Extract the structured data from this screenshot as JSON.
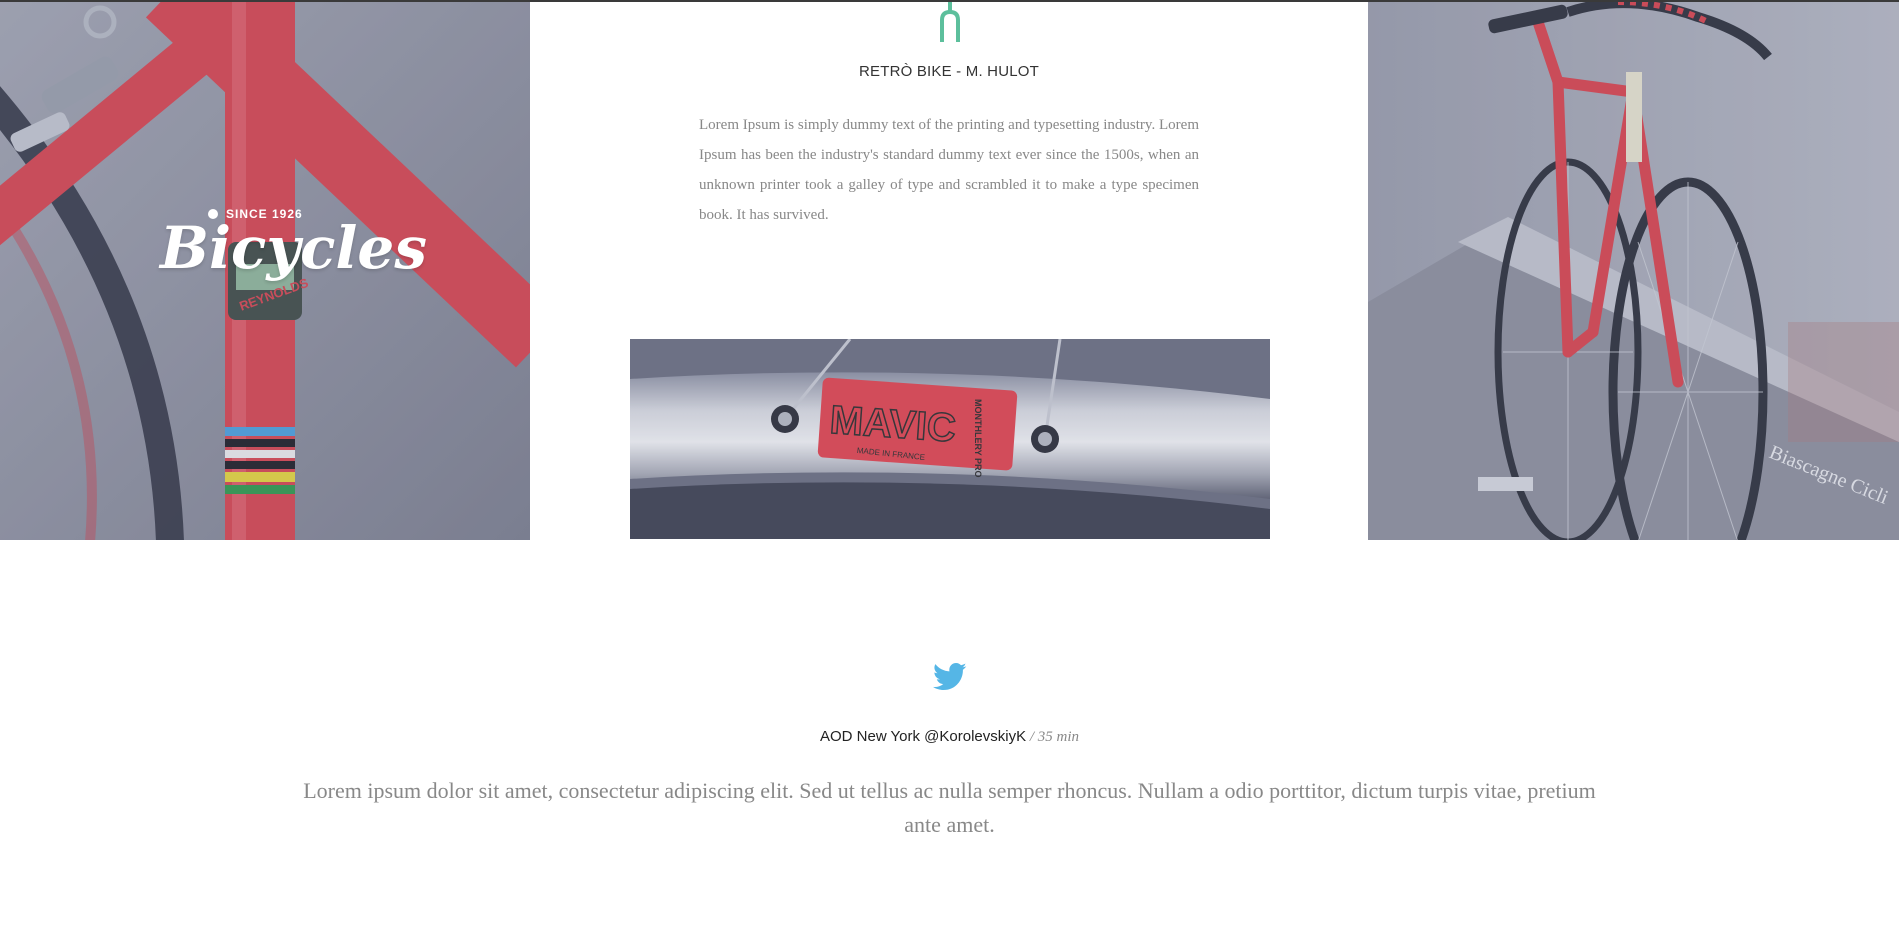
{
  "brand": {
    "since": "SINCE 1926",
    "name": "Bicycles"
  },
  "center": {
    "icon": "bicycle-fork-icon",
    "title": "RETRÒ BIKE - M. HULOT",
    "body": "Lorem Ipsum is simply dummy text of the printing and typesetting industry. Lorem Ipsum has been the industry's standard dummy text ever since the 1500s, when an unknown printer took a galley of type and scrambled it to make a type specimen book. It has survived."
  },
  "images": {
    "left": {
      "decal_text": "REYNOLDS"
    },
    "rim": {
      "decal_text": "MAVIC",
      "side_text": "MONTHLERY PRO",
      "small_text": "MADE IN FRANCE"
    },
    "right": {
      "wall_text": "Biascagne Cicli"
    }
  },
  "tweet": {
    "icon": "twitter-icon",
    "author": "AOD New York @KorolevskiyK",
    "time": " / 35 min",
    "text": "Lorem ipsum dolor sit amet, consectetur adipiscing elit. Sed ut tellus ac nulla semper rhoncus. Nullam a odio porttitor, dictum turpis vitae, pretium ante amet."
  },
  "colors": {
    "accent_fork": "#5cbf9c",
    "twitter_blue": "#55b6e6",
    "bike_red": "#d9434e"
  }
}
